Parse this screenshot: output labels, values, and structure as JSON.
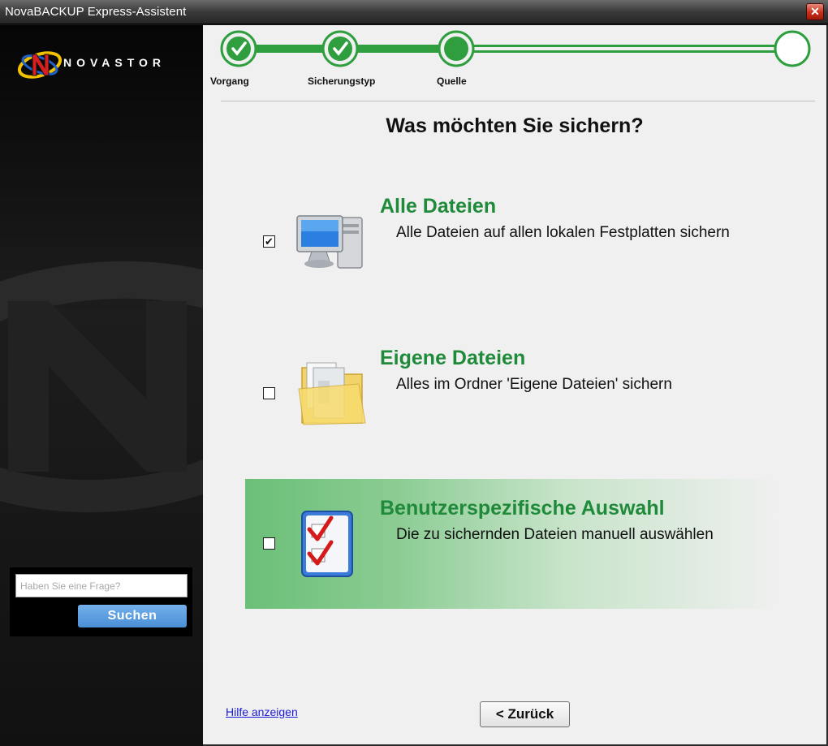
{
  "window": {
    "title": "NovaBACKUP Express-Assistent",
    "close_glyph": "✕"
  },
  "sidebar": {
    "logo_text": "NOVASTOR",
    "search": {
      "placeholder": "Haben Sie eine Frage?",
      "button_label": "Suchen"
    }
  },
  "steps": [
    {
      "label": "Vorgang",
      "status": "completed"
    },
    {
      "label": "Sicherungstyp",
      "status": "completed"
    },
    {
      "label": "Quelle",
      "status": "current"
    },
    {
      "label": "",
      "status": "pending"
    }
  ],
  "page": {
    "heading": "Was möchten Sie sichern?"
  },
  "options": [
    {
      "title": "Alle Dateien",
      "description": "Alle Dateien auf allen lokalen Festplatten sichern",
      "checked": true,
      "checkmark": "✔",
      "icon": "computer-icon"
    },
    {
      "title": "Eigene Dateien",
      "description": "Alles im Ordner 'Eigene Dateien' sichern",
      "checked": false,
      "checkmark": "",
      "icon": "folder-icon"
    },
    {
      "title": "Benutzerspezifische Auswahl",
      "description": "Die zu sichernden Dateien manuell auswählen",
      "checked": false,
      "checkmark": "",
      "icon": "checklist-icon",
      "highlighted": true
    }
  ],
  "footer": {
    "help_link": "Hilfe anzeigen",
    "back_button": "< Zurück"
  },
  "colors": {
    "accent_green": "#2e9e3e",
    "title_green": "#1f8a3a",
    "search_button_blue": "#5a9fe0",
    "highlight_green": "#6bbf77"
  }
}
